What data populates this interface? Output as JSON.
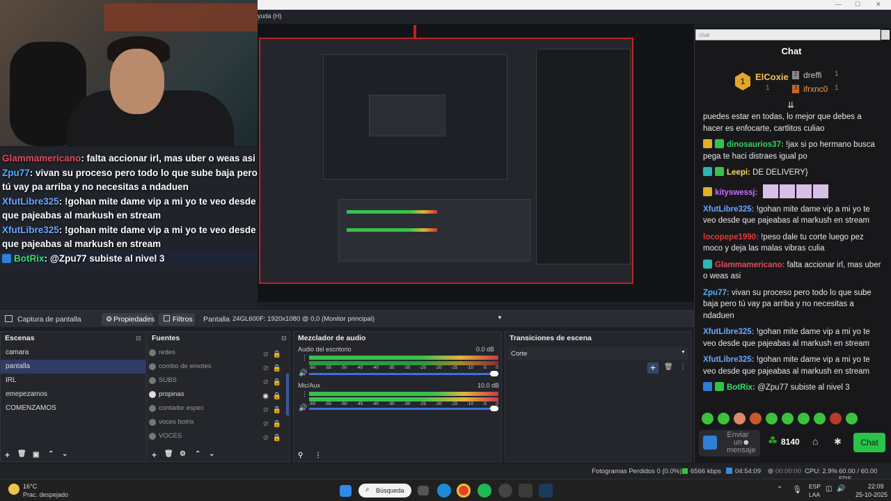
{
  "window": {
    "menu_fragment": "yuda (H)"
  },
  "overlay_chat": [
    {
      "user": "Glammamericano",
      "color": "#e04a5c",
      "text": ": falta accionar irl, mas uber o weas asi"
    },
    {
      "user": "Zpu77",
      "color": "#4db2ff",
      "text": ": vivan su proceso pero todo lo que sube baja pero tú vay pa arriba y no necesitas a ndaduen"
    },
    {
      "user": "XfutLibre325",
      "color": "#6aa8ff",
      "text": ": !gohan mite dame vip a mi yo te veo desde que pajeabas al markush en stream"
    },
    {
      "user": "XfutLibre325",
      "color": "#6aa8ff",
      "text": ": !gohan mite dame vip a mi yo te veo desde que pajeabas al markush en stream"
    },
    {
      "user": "BotRix",
      "color": "#3ddc6a",
      "text": ": @Zpu77 subiste al nivel 3"
    }
  ],
  "docktabs": {
    "capture": "Captura de pantalla",
    "properties": "Propiedades",
    "filters": "Filtros",
    "screen_label": "Pantalla",
    "monitor": "24GL600F: 1920x1080 @ 0,0 (Monitor principal)"
  },
  "scenes": {
    "title": "Escenas",
    "items": [
      "camara",
      "pantalla",
      "IRL",
      "emepezamos",
      "COMENZAMOS"
    ]
  },
  "sources": {
    "title": "Fuentes",
    "items": [
      "redes",
      "combo de emotes",
      "SUBS",
      "propinas",
      "contador espec",
      "voces botrix",
      "VOCES"
    ]
  },
  "mixer": {
    "title": "Mezclador de audio",
    "ch1_name": "Audio del escritorio",
    "ch1_db": "0.0 dB",
    "ch2_name": "Mic/Aux",
    "ch2_db": "10.0 dB",
    "ticks": [
      "-60",
      "-55",
      "-50",
      "-45",
      "-40",
      "-35",
      "-30",
      "-25",
      "-20",
      "-15",
      "-10",
      "-5",
      "0"
    ]
  },
  "transitions": {
    "title": "Transiciones de escena",
    "selected": "Corte"
  },
  "chat": {
    "search": "chat",
    "title": "Chat",
    "leader1": "ElCoxie",
    "leader1_count": "1",
    "leader2": "dreffi",
    "leader2_count": "1",
    "leader3": "ifrxnc0",
    "leader3_count": "1",
    "rank1": "1",
    "rank2": "2",
    "rank3": "3",
    "messages": [
      {
        "user": "",
        "color": "#e8e8e8",
        "text": "puedes estar en todas, lo mejor que debes a hacer es enfocarte, cartlitos culiao"
      },
      {
        "user": "dinosaurios37:",
        "color": "#35d05b",
        "text": " !jax si po hermano busca pega te haci distraes igual po"
      },
      {
        "user": "Leepi:",
        "color": "#f6e05c",
        "text": " DE DELIVERY}"
      },
      {
        "user": "kityswessj:",
        "color": "#c86dff",
        "text": ""
      },
      {
        "user": "XfutLibre325:",
        "color": "#6aa8ff",
        "text": " !gohan mite dame vip a mi yo te veo desde que pajeabas al markush en stream"
      },
      {
        "user": "locopepe1990:",
        "color": "#e03a3a",
        "text": " !peso dale tu corte luego pez moco y deja las malas vibras culia"
      },
      {
        "user": "Glammamericano:",
        "color": "#e04a5c",
        "text": " falta accionar irl, mas uber o weas asi"
      },
      {
        "user": "Zpu77:",
        "color": "#4db2ff",
        "text": " vivan su proceso pero todo lo que sube baja pero tú vay pa arriba y no necesitas a ndaduen"
      },
      {
        "user": "XfutLibre325:",
        "color": "#6aa8ff",
        "text": " !gohan mite dame vip a mi yo te veo desde que pajeabas al markush en stream"
      },
      {
        "user": "XfutLibre325:",
        "color": "#6aa8ff",
        "text": " !gohan mite dame vip a mi yo te veo desde que pajeabas al markush en stream"
      },
      {
        "user": "BotRix:",
        "color": "#3ddc6a",
        "text": " @Zpu77 subiste al nivel 3"
      }
    ],
    "input_placeholder": "Enviar un mensaje",
    "points": "8140",
    "send": "Chat"
  },
  "status": {
    "dropped": "Fotogramas Perdidos 0 (0.0%)",
    "bitrate": "6566 kbps",
    "live_time": "04:54:09",
    "rec_time": "00:00:00",
    "cpu": "CPU: 2.9%",
    "fps": "60.00 / 60.00 FPS"
  },
  "taskbar": {
    "temp": "16°C",
    "weather": "Prac. despejado",
    "search": "Búsqueda",
    "lang1": "ESP",
    "lang2": "LAA",
    "time": "22:09",
    "date": "25-10-2025"
  }
}
